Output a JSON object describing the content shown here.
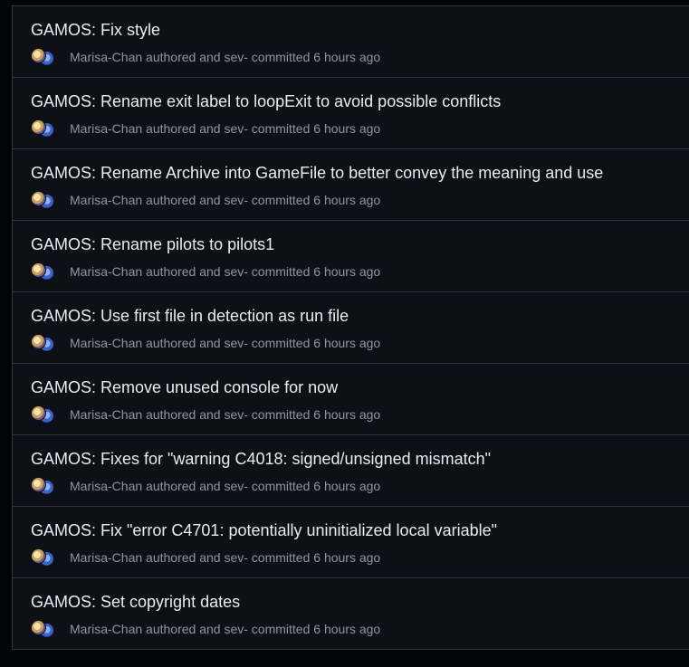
{
  "commits": [
    {
      "title": "GAMOS: Fix style",
      "author": "Marisa-Chan",
      "authored_label": "authored and",
      "committer": "sev-",
      "committed_label": "committed",
      "time": "6 hours ago"
    },
    {
      "title": "GAMOS: Rename exit label to loopExit to avoid possible conflicts",
      "author": "Marisa-Chan",
      "authored_label": "authored and",
      "committer": "sev-",
      "committed_label": "committed",
      "time": "6 hours ago"
    },
    {
      "title": "GAMOS: Rename Archive into GameFile to better convey the meaning and use",
      "author": "Marisa-Chan",
      "authored_label": "authored and",
      "committer": "sev-",
      "committed_label": "committed",
      "time": "6 hours ago"
    },
    {
      "title": "GAMOS: Rename pilots to pilots1",
      "author": "Marisa-Chan",
      "authored_label": "authored and",
      "committer": "sev-",
      "committed_label": "committed",
      "time": "6 hours ago"
    },
    {
      "title": "GAMOS: Use first file in detection as run file",
      "author": "Marisa-Chan",
      "authored_label": "authored and",
      "committer": "sev-",
      "committed_label": "committed",
      "time": "6 hours ago"
    },
    {
      "title": "GAMOS: Remove unused console for now",
      "author": "Marisa-Chan",
      "authored_label": "authored and",
      "committer": "sev-",
      "committed_label": "committed",
      "time": "6 hours ago"
    },
    {
      "title": "GAMOS: Fixes for \"warning C4018: signed/unsigned mismatch\"",
      "author": "Marisa-Chan",
      "authored_label": "authored and",
      "committer": "sev-",
      "committed_label": "committed",
      "time": "6 hours ago"
    },
    {
      "title": "GAMOS: Fix \"error C4701: potentially uninitialized local variable\"",
      "author": "Marisa-Chan",
      "authored_label": "authored and",
      "committer": "sev-",
      "committed_label": "committed",
      "time": "6 hours ago"
    },
    {
      "title": "GAMOS: Set copyright dates",
      "author": "Marisa-Chan",
      "authored_label": "authored and",
      "committer": "sev-",
      "committed_label": "committed",
      "time": "6 hours ago"
    }
  ]
}
